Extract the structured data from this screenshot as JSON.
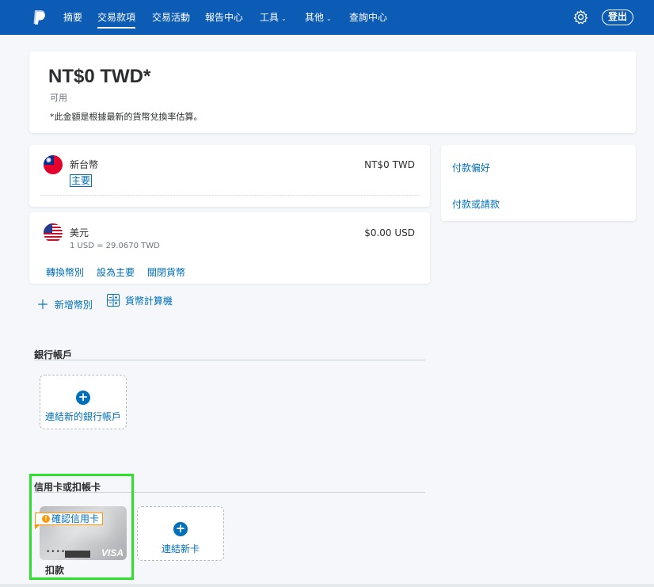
{
  "nav": {
    "items": [
      {
        "label": "摘要"
      },
      {
        "label": "交易款項"
      },
      {
        "label": "交易活動"
      },
      {
        "label": "報告中心"
      },
      {
        "label": "工具"
      },
      {
        "label": "其他"
      },
      {
        "label": "查詢中心"
      }
    ],
    "logout": "登出",
    "icons": {
      "logo": "paypal-logo",
      "settings": "gear-icon"
    }
  },
  "balance": {
    "amount": "NT$0 TWD*",
    "available": "可用",
    "note": "*此金額是根據最新的貨幣兌換率估算。"
  },
  "currencies": [
    {
      "name": "新台幣",
      "badge": "主要",
      "amount": "NT$0 TWD",
      "flag": "taiwan-flag"
    },
    {
      "name": "美元",
      "rate": "1 USD = 29.0670 TWD",
      "amount": "$0.00 USD",
      "flag": "us-flag",
      "actions": [
        "轉換幣別",
        "設為主要",
        "關閉貨幣"
      ]
    }
  ],
  "currency_tools": {
    "add": "新增幣別",
    "calculator": "貨幣計算機"
  },
  "side_links": [
    "付款偏好",
    "付款或請款"
  ],
  "bank": {
    "title": "銀行帳戶",
    "link_label": "連結新的銀行帳戶"
  },
  "cards": {
    "title": "信用卡或扣帳卡",
    "confirm_label": "確認信用卡",
    "card_dots": "••••",
    "card_brand": "VISA",
    "card_type": "扣款",
    "link_label": "連結新卡"
  },
  "colors": {
    "nav_bg": "#0c5bb5",
    "link": "#0070ba",
    "highlight": "#2de12d",
    "warning": "#ff9600"
  }
}
